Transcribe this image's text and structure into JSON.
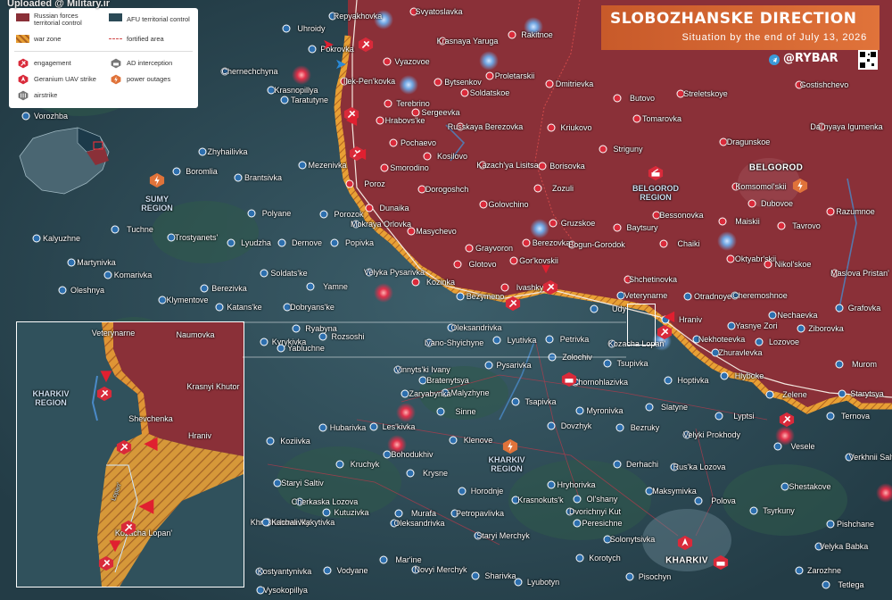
{
  "watermark": "Uploaded @ Military.ir",
  "title": {
    "main": "SLOBOZHANSKE DIRECTION",
    "subtitle": "Situation by the end of July 13, 2026"
  },
  "brand": "@RYBAR",
  "legend": {
    "items": [
      {
        "label": "Russian forces\nterritorial control",
        "swatch": "russian"
      },
      {
        "label": "AFU territorial control",
        "swatch": "afu"
      },
      {
        "label": "war zone",
        "swatch": "warzone"
      },
      {
        "label": "fortified area",
        "swatch": "fortified"
      },
      {
        "label": "engagement",
        "swatch": "engagement"
      },
      {
        "label": "AD interception",
        "swatch": "ad"
      },
      {
        "label": "Geranium UAV strike",
        "swatch": "uav"
      },
      {
        "label": "power outages",
        "swatch": "power"
      },
      {
        "label": "airstrike",
        "swatch": "airstrike"
      }
    ]
  },
  "colors": {
    "russian": "#8a3038",
    "afu": "#2b4a56",
    "warzone": "#e8a035",
    "accent": "#e0733a",
    "engagement": "#d92a3a"
  },
  "regions": [
    {
      "id": "sumy",
      "name": "SUMY\nREGION"
    },
    {
      "id": "belgorod-reg",
      "name": "BELGOROD\nREGION"
    },
    {
      "id": "kharkiv-reg",
      "name": "KHARKIV\nREGION"
    },
    {
      "id": "belgorod-city",
      "name": "BELGOROD"
    },
    {
      "id": "kharkiv-city",
      "name": "KHARKIV"
    }
  ],
  "places": [
    "Repyakhovka",
    "Svyatoslavka",
    "Rakitnoe",
    "Uhroidy",
    "Krasnaya Yaruga",
    "Pokrovka",
    "Vyazovoe",
    "Proletarskii",
    "Chernechchyna",
    "Ilek-Pen'kovka",
    "Bytsenkov",
    "Dmitrievka",
    "Gostishchevo",
    "Krasnopillya",
    "Soldatskoe",
    "Butovo",
    "Streletskoye",
    "Taratutyne",
    "Terebrino",
    "Sergeevka",
    "Hrabovs'ke",
    "Russkaya Berezovka",
    "Tomarovka",
    "Dal'nyaya Igumenka",
    "Vorozhba",
    "Pochaevo",
    "Kriukovo",
    "Striguny",
    "Dragunskoe",
    "Kosilovo",
    "Mezenivka",
    "Smorodino",
    "Kazach'ya Lisitsa",
    "Borisovka",
    "Zhyhailivka",
    "Boromlia",
    "Brantsivka",
    "Poroz",
    "Dorogoshch",
    "Zozuli",
    "Komsomol'skii",
    "Dubovoe",
    "Dunaika",
    "Golovchino",
    "Gruzskoe",
    "Polyane",
    "Porozok",
    "Mokraya Orlovka",
    "Baytsury",
    "Bessonovka",
    "Maiskii",
    "Tavrovo",
    "Razumnoe",
    "Kalyuzhne",
    "Tuchne",
    "Trostyanets'",
    "Lyudzha",
    "Dernove",
    "Popivka",
    "Masychevo",
    "Grayvoron",
    "Berezovka",
    "Bogun-Gorodok",
    "Chaiki",
    "Oktyabr'skii",
    "Nikol'skoe",
    "Maslova Pristan'",
    "Martynivka",
    "Komarivka",
    "Velyka Pysarivka",
    "Gor'kovskii",
    "Glotovo",
    "Shchetinovka",
    "Oleshnya",
    "Berezivka",
    "Soldats'ke",
    "Yamne",
    "Kozinka",
    "Bezymeno",
    "Ivashky",
    "Veterynarne",
    "Otradnoye",
    "Cheremoshnoe",
    "Klymentove",
    "Katans'ke",
    "Dobryans'ke",
    "Ryabyna",
    "Hraniv",
    "Udy",
    "Nechaevka",
    "Grafovka",
    "Kyrykivka",
    "Rozsoshi",
    "Oleksandrivka",
    "Lyutivka",
    "Petrivka",
    "Kozacha Lopan'",
    "Nekhoteevka",
    "Yasnye Zori",
    "Ziborovka",
    "Ivano-Shyichyne",
    "Zhuravlevka",
    "Lozovoe",
    "Yabluchne",
    "Vinnyts'ki Ivany",
    "Pysarivka",
    "Zolochiv",
    "Tsupivka",
    "Hlyboke",
    "Murom",
    "Bratenytsya",
    "Chornohlazivka",
    "Hoptivka",
    "Malyzhyne",
    "Zaryabynka",
    "Tsapivka",
    "Zelene",
    "Starytsya",
    "Sinne",
    "Myronivka",
    "Slatyne",
    "Lyptsi",
    "Ternova",
    "Koziivka",
    "Hubarivka",
    "Les'kivka",
    "Dovzhyk",
    "Bezruky",
    "Velyki Prokhody",
    "Vesele",
    "Klenove",
    "Verkhnii Saltiv",
    "Bohodukhiv",
    "Kruchyk",
    "Derhachi",
    "Rus'ka Lozova",
    "Krysne",
    "Hryhorivka",
    "Shestakove",
    "Staryi Saltiv",
    "Horodnje",
    "Maksymivka",
    "Cherkaska Lozova",
    "Krasnokuts'k",
    "Ol'shany",
    "Polova",
    "Tsyrkuny",
    "Kutuzivka",
    "Murafa",
    "Khrushchova Mykytivka",
    "Dvorichnyi Kut",
    "Pishchane",
    "Kachalivka",
    "Petropavlivka",
    "Peresichne",
    "Oleksandrivka",
    "Solonytsivka",
    "Velyka Babka",
    "Staryi Merchyk",
    "Kostyantynivka",
    "Mar'ine",
    "Korotych",
    "Novyi Merchyk",
    "Zarozhne",
    "Vodyane",
    "Sharivka",
    "Vysokopillya",
    "Lyubotyn",
    "Pisochyn",
    "Tetlega"
  ],
  "inset": {
    "places": [
      "Veterynarne",
      "Naumovka",
      "Krasnyi Khutor",
      "Shevchenka",
      "Hraniv",
      "Kozacha Lopan'"
    ],
    "region": "KHARKIV\nREGION",
    "river": "Lopan'"
  }
}
